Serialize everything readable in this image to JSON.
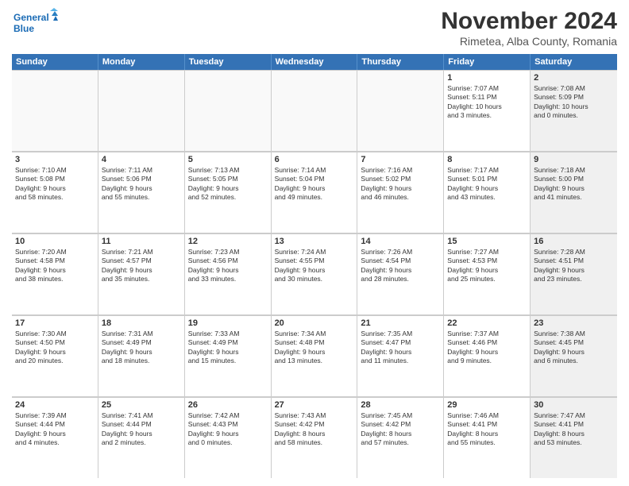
{
  "logo": {
    "line1": "General",
    "line2": "Blue"
  },
  "title": "November 2024",
  "subtitle": "Rimetea, Alba County, Romania",
  "days_header": [
    "Sunday",
    "Monday",
    "Tuesday",
    "Wednesday",
    "Thursday",
    "Friday",
    "Saturday"
  ],
  "weeks": [
    [
      {
        "day": "",
        "info": "",
        "empty": true
      },
      {
        "day": "",
        "info": "",
        "empty": true
      },
      {
        "day": "",
        "info": "",
        "empty": true
      },
      {
        "day": "",
        "info": "",
        "empty": true
      },
      {
        "day": "",
        "info": "",
        "empty": true
      },
      {
        "day": "1",
        "info": "Sunrise: 7:07 AM\nSunset: 5:11 PM\nDaylight: 10 hours\nand 3 minutes.",
        "empty": false,
        "shaded": false
      },
      {
        "day": "2",
        "info": "Sunrise: 7:08 AM\nSunset: 5:09 PM\nDaylight: 10 hours\nand 0 minutes.",
        "empty": false,
        "shaded": true
      }
    ],
    [
      {
        "day": "3",
        "info": "Sunrise: 7:10 AM\nSunset: 5:08 PM\nDaylight: 9 hours\nand 58 minutes.",
        "empty": false,
        "shaded": false
      },
      {
        "day": "4",
        "info": "Sunrise: 7:11 AM\nSunset: 5:06 PM\nDaylight: 9 hours\nand 55 minutes.",
        "empty": false,
        "shaded": false
      },
      {
        "day": "5",
        "info": "Sunrise: 7:13 AM\nSunset: 5:05 PM\nDaylight: 9 hours\nand 52 minutes.",
        "empty": false,
        "shaded": false
      },
      {
        "day": "6",
        "info": "Sunrise: 7:14 AM\nSunset: 5:04 PM\nDaylight: 9 hours\nand 49 minutes.",
        "empty": false,
        "shaded": false
      },
      {
        "day": "7",
        "info": "Sunrise: 7:16 AM\nSunset: 5:02 PM\nDaylight: 9 hours\nand 46 minutes.",
        "empty": false,
        "shaded": false
      },
      {
        "day": "8",
        "info": "Sunrise: 7:17 AM\nSunset: 5:01 PM\nDaylight: 9 hours\nand 43 minutes.",
        "empty": false,
        "shaded": false
      },
      {
        "day": "9",
        "info": "Sunrise: 7:18 AM\nSunset: 5:00 PM\nDaylight: 9 hours\nand 41 minutes.",
        "empty": false,
        "shaded": true
      }
    ],
    [
      {
        "day": "10",
        "info": "Sunrise: 7:20 AM\nSunset: 4:58 PM\nDaylight: 9 hours\nand 38 minutes.",
        "empty": false,
        "shaded": false
      },
      {
        "day": "11",
        "info": "Sunrise: 7:21 AM\nSunset: 4:57 PM\nDaylight: 9 hours\nand 35 minutes.",
        "empty": false,
        "shaded": false
      },
      {
        "day": "12",
        "info": "Sunrise: 7:23 AM\nSunset: 4:56 PM\nDaylight: 9 hours\nand 33 minutes.",
        "empty": false,
        "shaded": false
      },
      {
        "day": "13",
        "info": "Sunrise: 7:24 AM\nSunset: 4:55 PM\nDaylight: 9 hours\nand 30 minutes.",
        "empty": false,
        "shaded": false
      },
      {
        "day": "14",
        "info": "Sunrise: 7:26 AM\nSunset: 4:54 PM\nDaylight: 9 hours\nand 28 minutes.",
        "empty": false,
        "shaded": false
      },
      {
        "day": "15",
        "info": "Sunrise: 7:27 AM\nSunset: 4:53 PM\nDaylight: 9 hours\nand 25 minutes.",
        "empty": false,
        "shaded": false
      },
      {
        "day": "16",
        "info": "Sunrise: 7:28 AM\nSunset: 4:51 PM\nDaylight: 9 hours\nand 23 minutes.",
        "empty": false,
        "shaded": true
      }
    ],
    [
      {
        "day": "17",
        "info": "Sunrise: 7:30 AM\nSunset: 4:50 PM\nDaylight: 9 hours\nand 20 minutes.",
        "empty": false,
        "shaded": false
      },
      {
        "day": "18",
        "info": "Sunrise: 7:31 AM\nSunset: 4:49 PM\nDaylight: 9 hours\nand 18 minutes.",
        "empty": false,
        "shaded": false
      },
      {
        "day": "19",
        "info": "Sunrise: 7:33 AM\nSunset: 4:49 PM\nDaylight: 9 hours\nand 15 minutes.",
        "empty": false,
        "shaded": false
      },
      {
        "day": "20",
        "info": "Sunrise: 7:34 AM\nSunset: 4:48 PM\nDaylight: 9 hours\nand 13 minutes.",
        "empty": false,
        "shaded": false
      },
      {
        "day": "21",
        "info": "Sunrise: 7:35 AM\nSunset: 4:47 PM\nDaylight: 9 hours\nand 11 minutes.",
        "empty": false,
        "shaded": false
      },
      {
        "day": "22",
        "info": "Sunrise: 7:37 AM\nSunset: 4:46 PM\nDaylight: 9 hours\nand 9 minutes.",
        "empty": false,
        "shaded": false
      },
      {
        "day": "23",
        "info": "Sunrise: 7:38 AM\nSunset: 4:45 PM\nDaylight: 9 hours\nand 6 minutes.",
        "empty": false,
        "shaded": true
      }
    ],
    [
      {
        "day": "24",
        "info": "Sunrise: 7:39 AM\nSunset: 4:44 PM\nDaylight: 9 hours\nand 4 minutes.",
        "empty": false,
        "shaded": false
      },
      {
        "day": "25",
        "info": "Sunrise: 7:41 AM\nSunset: 4:44 PM\nDaylight: 9 hours\nand 2 minutes.",
        "empty": false,
        "shaded": false
      },
      {
        "day": "26",
        "info": "Sunrise: 7:42 AM\nSunset: 4:43 PM\nDaylight: 9 hours\nand 0 minutes.",
        "empty": false,
        "shaded": false
      },
      {
        "day": "27",
        "info": "Sunrise: 7:43 AM\nSunset: 4:42 PM\nDaylight: 8 hours\nand 58 minutes.",
        "empty": false,
        "shaded": false
      },
      {
        "day": "28",
        "info": "Sunrise: 7:45 AM\nSunset: 4:42 PM\nDaylight: 8 hours\nand 57 minutes.",
        "empty": false,
        "shaded": false
      },
      {
        "day": "29",
        "info": "Sunrise: 7:46 AM\nSunset: 4:41 PM\nDaylight: 8 hours\nand 55 minutes.",
        "empty": false,
        "shaded": false
      },
      {
        "day": "30",
        "info": "Sunrise: 7:47 AM\nSunset: 4:41 PM\nDaylight: 8 hours\nand 53 minutes.",
        "empty": false,
        "shaded": true
      }
    ]
  ]
}
